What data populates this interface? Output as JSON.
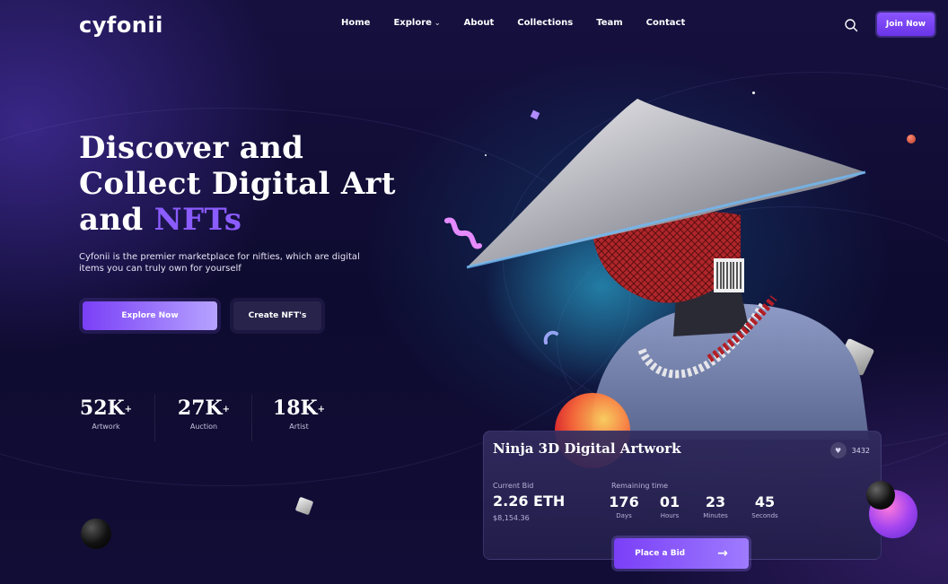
{
  "brand": {
    "logo_text": "cyfonii"
  },
  "nav": {
    "items": [
      {
        "label": "Home"
      },
      {
        "label": "Explore"
      },
      {
        "label": "About"
      },
      {
        "label": "Collections"
      },
      {
        "label": "Team"
      },
      {
        "label": "Contact"
      }
    ],
    "join_label": "Join Now"
  },
  "hero": {
    "title_line1": "Discover and",
    "title_line2": "Collect Digital Art",
    "title_line3_prefix": "and ",
    "title_line3_accent": "NFTs",
    "description": "Cyfonii is the premier marketplace for nifties, which are digital items you can truly own for yourself",
    "explore_label": "Explore Now",
    "create_label": "Create NFT's"
  },
  "stats": [
    {
      "value": "52K",
      "suffix": "+",
      "label": "Artwork"
    },
    {
      "value": "27K",
      "suffix": "+",
      "label": "Auction"
    },
    {
      "value": "18K",
      "suffix": "+",
      "label": "Artist"
    }
  ],
  "card": {
    "title": "Ninja 3D Digital Artwork",
    "likes": "3432",
    "current_bid_label": "Current Bid",
    "current_bid_value": "2.26 ETH",
    "current_bid_usd": "$8,154.36",
    "remaining_label": "Remaining time",
    "timer": [
      {
        "value": "176",
        "label": "Days"
      },
      {
        "value": "01",
        "label": "Hours"
      },
      {
        "value": "23",
        "label": "Minutes"
      },
      {
        "value": "45",
        "label": "Seconds"
      }
    ],
    "bid_button_label": "Place a Bid"
  },
  "colors": {
    "accent": "#8b5cff",
    "background": "#0d0a2a",
    "button_primary": "#7a3ff7"
  },
  "icons": {
    "search": "search-icon",
    "heart": "heart-icon",
    "arrow": "arrow-right-icon",
    "chevron": "chevron-down-icon"
  }
}
